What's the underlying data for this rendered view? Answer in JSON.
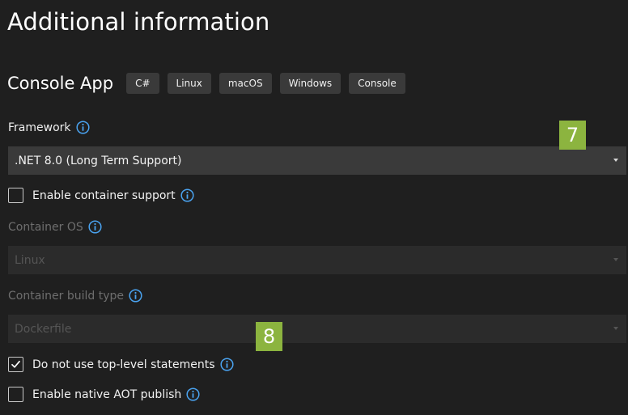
{
  "dialog": {
    "title": "Additional information"
  },
  "template": {
    "name": "Console App",
    "tags": [
      "C#",
      "Linux",
      "macOS",
      "Windows",
      "Console"
    ]
  },
  "framework": {
    "label": "Framework",
    "selected": ".NET 8.0 (Long Term Support)"
  },
  "container_support": {
    "label": "Enable container support",
    "checked": false
  },
  "container_os": {
    "label": "Container OS",
    "selected": "Linux",
    "disabled": true
  },
  "container_build_type": {
    "label": "Container build type",
    "selected": "Dockerfile",
    "disabled": true
  },
  "top_level_statements": {
    "label": "Do not use top-level statements",
    "checked": true
  },
  "native_aot": {
    "label": "Enable native AOT publish",
    "checked": false
  },
  "annotations": {
    "step_7": "7",
    "step_8": "8"
  },
  "colors": {
    "background": "#1f1f1f",
    "input": "#3a3a3a",
    "info_icon": "#4aa3f0",
    "badge": "#8cb43f"
  },
  "icons": {
    "info": "info-circle-icon",
    "dropdown": "chevron-down-icon",
    "check": "checkmark-icon"
  }
}
